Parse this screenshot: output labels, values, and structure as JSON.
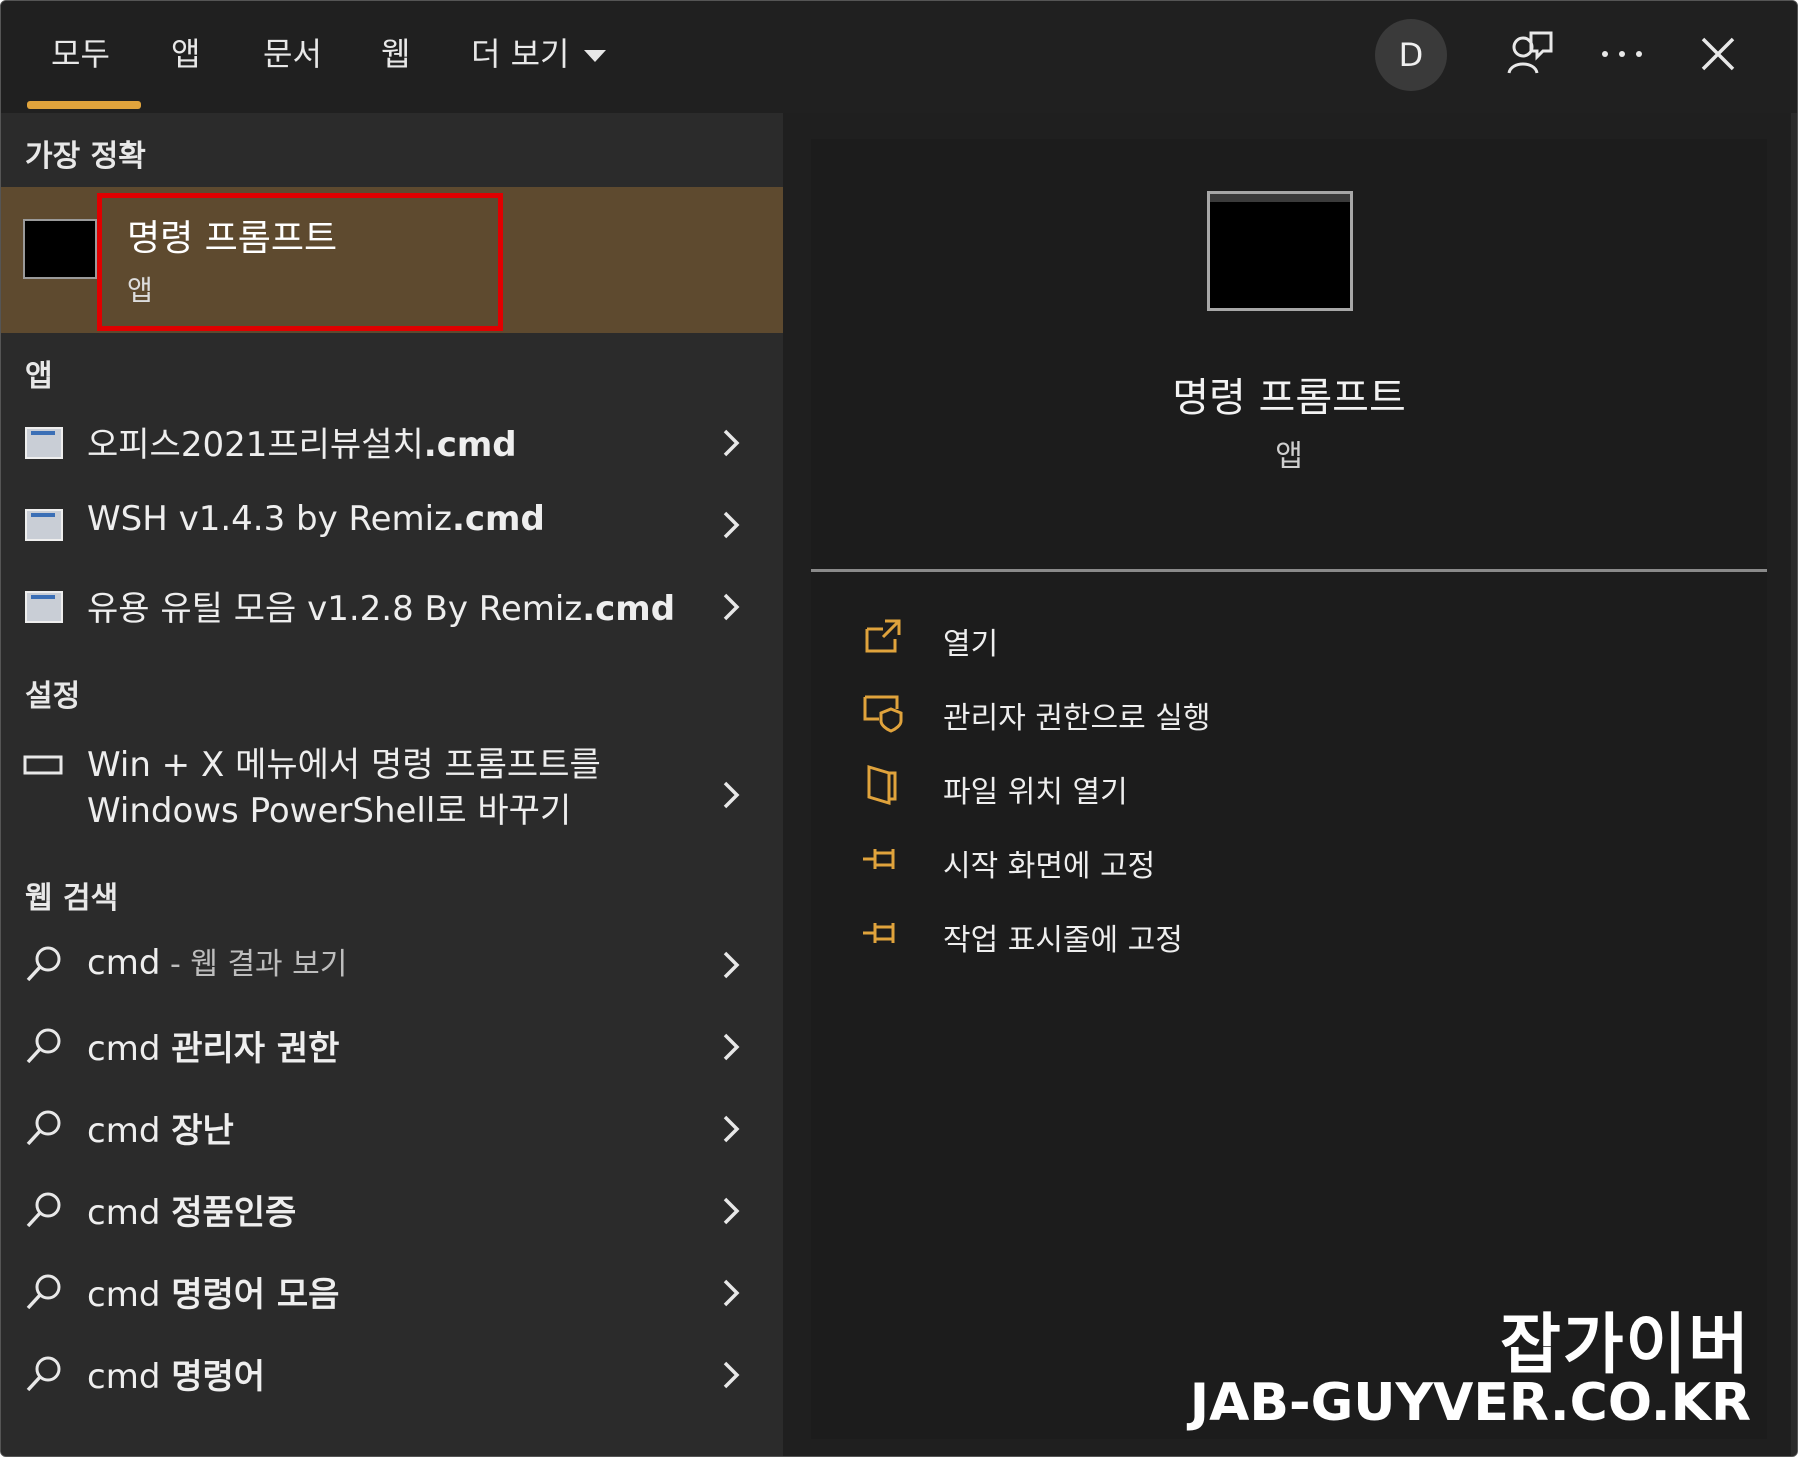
{
  "tabs": [
    {
      "label": "모두"
    },
    {
      "label": "앱"
    },
    {
      "label": "문서"
    },
    {
      "label": "웹"
    },
    {
      "label": "더 보기"
    }
  ],
  "header": {
    "avatar_letter": "D"
  },
  "best_match": {
    "section": "가장 정확",
    "title": "명령 프롬프트",
    "subtitle": "앱"
  },
  "apps": {
    "section": "앱",
    "items": [
      {
        "prefix": "오피스2021프리뷰설치",
        "ext": ".cmd"
      },
      {
        "prefix": "WSH v1.4.3 by Remiz",
        "ext": ".cmd"
      },
      {
        "prefix": "유용 유틸 모음 v1.2.8 By Remiz",
        "ext": ".cmd"
      }
    ]
  },
  "settings": {
    "section": "설정",
    "line1": "Win + X 메뉴에서 명령 프롬프트를",
    "line2": "Windows PowerShell로 바꾸기"
  },
  "web": {
    "section": "웹 검색",
    "first": {
      "q": "cmd",
      "suffix": " - 웹 결과 보기"
    },
    "items": [
      {
        "q": "cmd",
        "bold": "관리자 권한"
      },
      {
        "q": "cmd",
        "bold": "장난"
      },
      {
        "q": "cmd",
        "bold": "정품인증"
      },
      {
        "q": "cmd",
        "bold": "명령어 모음"
      },
      {
        "q": "cmd",
        "bold": "명령어"
      }
    ]
  },
  "detail": {
    "title": "명령 프롬프트",
    "subtitle": "앱",
    "actions": [
      {
        "label": "열기"
      },
      {
        "label": "관리자 권한으로 실행"
      },
      {
        "label": "파일 위치 열기"
      },
      {
        "label": "시작 화면에 고정"
      },
      {
        "label": "작업 표시줄에 고정"
      }
    ]
  },
  "watermark": {
    "ko": "잡가이버",
    "en": "JAB-GUYVER.CO.KR"
  },
  "colors": {
    "accent": "#e0a33c",
    "selected_bg": "#5e4a2f",
    "highlight_border": "#e00000"
  }
}
